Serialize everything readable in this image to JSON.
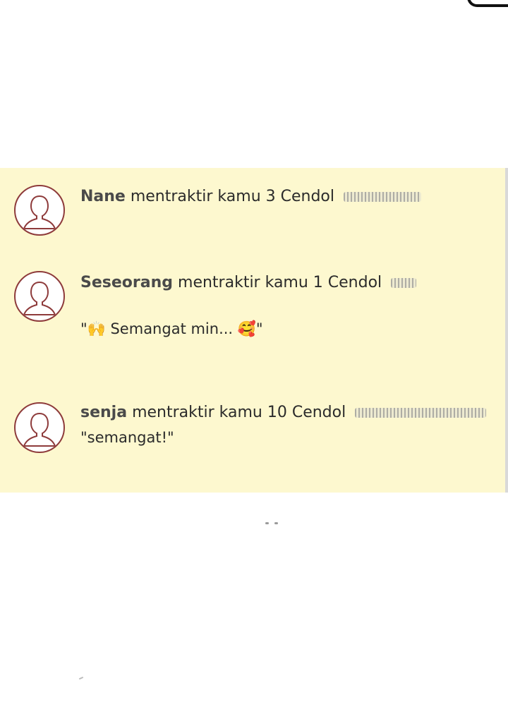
{
  "notifications": [
    {
      "name": "Nane",
      "text": "mentraktir kamu 3 Cendol",
      "message": ""
    },
    {
      "name": "Seseorang",
      "text": "mentraktir kamu 1 Cendol",
      "message": "\"🙌 Semangat min... 🥰\""
    },
    {
      "name": "senja",
      "text": "mentraktir kamu 10 Cendol",
      "message": "\"semangat!\""
    }
  ],
  "icons": {
    "avatar": "default-user-avatar-icon"
  },
  "colors": {
    "panel_background": "#fdf8cf",
    "avatar_border": "#8e3b3b",
    "text": "#2b2b2b"
  }
}
